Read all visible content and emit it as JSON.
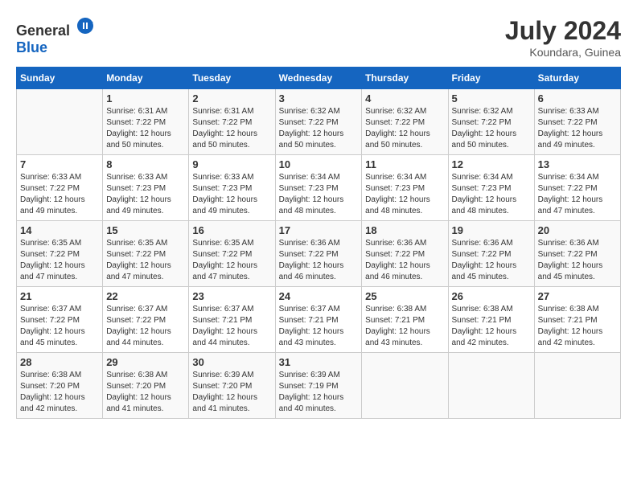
{
  "header": {
    "logo_general": "General",
    "logo_blue": "Blue",
    "month_year": "July 2024",
    "location": "Koundara, Guinea"
  },
  "days_of_week": [
    "Sunday",
    "Monday",
    "Tuesday",
    "Wednesday",
    "Thursday",
    "Friday",
    "Saturday"
  ],
  "weeks": [
    [
      {
        "day": "",
        "sunrise": "",
        "sunset": "",
        "daylight": ""
      },
      {
        "day": "1",
        "sunrise": "Sunrise: 6:31 AM",
        "sunset": "Sunset: 7:22 PM",
        "daylight": "Daylight: 12 hours and 50 minutes."
      },
      {
        "day": "2",
        "sunrise": "Sunrise: 6:31 AM",
        "sunset": "Sunset: 7:22 PM",
        "daylight": "Daylight: 12 hours and 50 minutes."
      },
      {
        "day": "3",
        "sunrise": "Sunrise: 6:32 AM",
        "sunset": "Sunset: 7:22 PM",
        "daylight": "Daylight: 12 hours and 50 minutes."
      },
      {
        "day": "4",
        "sunrise": "Sunrise: 6:32 AM",
        "sunset": "Sunset: 7:22 PM",
        "daylight": "Daylight: 12 hours and 50 minutes."
      },
      {
        "day": "5",
        "sunrise": "Sunrise: 6:32 AM",
        "sunset": "Sunset: 7:22 PM",
        "daylight": "Daylight: 12 hours and 50 minutes."
      },
      {
        "day": "6",
        "sunrise": "Sunrise: 6:33 AM",
        "sunset": "Sunset: 7:22 PM",
        "daylight": "Daylight: 12 hours and 49 minutes."
      }
    ],
    [
      {
        "day": "7",
        "sunrise": "Sunrise: 6:33 AM",
        "sunset": "Sunset: 7:22 PM",
        "daylight": "Daylight: 12 hours and 49 minutes."
      },
      {
        "day": "8",
        "sunrise": "Sunrise: 6:33 AM",
        "sunset": "Sunset: 7:23 PM",
        "daylight": "Daylight: 12 hours and 49 minutes."
      },
      {
        "day": "9",
        "sunrise": "Sunrise: 6:33 AM",
        "sunset": "Sunset: 7:23 PM",
        "daylight": "Daylight: 12 hours and 49 minutes."
      },
      {
        "day": "10",
        "sunrise": "Sunrise: 6:34 AM",
        "sunset": "Sunset: 7:23 PM",
        "daylight": "Daylight: 12 hours and 48 minutes."
      },
      {
        "day": "11",
        "sunrise": "Sunrise: 6:34 AM",
        "sunset": "Sunset: 7:23 PM",
        "daylight": "Daylight: 12 hours and 48 minutes."
      },
      {
        "day": "12",
        "sunrise": "Sunrise: 6:34 AM",
        "sunset": "Sunset: 7:23 PM",
        "daylight": "Daylight: 12 hours and 48 minutes."
      },
      {
        "day": "13",
        "sunrise": "Sunrise: 6:34 AM",
        "sunset": "Sunset: 7:22 PM",
        "daylight": "Daylight: 12 hours and 47 minutes."
      }
    ],
    [
      {
        "day": "14",
        "sunrise": "Sunrise: 6:35 AM",
        "sunset": "Sunset: 7:22 PM",
        "daylight": "Daylight: 12 hours and 47 minutes."
      },
      {
        "day": "15",
        "sunrise": "Sunrise: 6:35 AM",
        "sunset": "Sunset: 7:22 PM",
        "daylight": "Daylight: 12 hours and 47 minutes."
      },
      {
        "day": "16",
        "sunrise": "Sunrise: 6:35 AM",
        "sunset": "Sunset: 7:22 PM",
        "daylight": "Daylight: 12 hours and 47 minutes."
      },
      {
        "day": "17",
        "sunrise": "Sunrise: 6:36 AM",
        "sunset": "Sunset: 7:22 PM",
        "daylight": "Daylight: 12 hours and 46 minutes."
      },
      {
        "day": "18",
        "sunrise": "Sunrise: 6:36 AM",
        "sunset": "Sunset: 7:22 PM",
        "daylight": "Daylight: 12 hours and 46 minutes."
      },
      {
        "day": "19",
        "sunrise": "Sunrise: 6:36 AM",
        "sunset": "Sunset: 7:22 PM",
        "daylight": "Daylight: 12 hours and 45 minutes."
      },
      {
        "day": "20",
        "sunrise": "Sunrise: 6:36 AM",
        "sunset": "Sunset: 7:22 PM",
        "daylight": "Daylight: 12 hours and 45 minutes."
      }
    ],
    [
      {
        "day": "21",
        "sunrise": "Sunrise: 6:37 AM",
        "sunset": "Sunset: 7:22 PM",
        "daylight": "Daylight: 12 hours and 45 minutes."
      },
      {
        "day": "22",
        "sunrise": "Sunrise: 6:37 AM",
        "sunset": "Sunset: 7:22 PM",
        "daylight": "Daylight: 12 hours and 44 minutes."
      },
      {
        "day": "23",
        "sunrise": "Sunrise: 6:37 AM",
        "sunset": "Sunset: 7:21 PM",
        "daylight": "Daylight: 12 hours and 44 minutes."
      },
      {
        "day": "24",
        "sunrise": "Sunrise: 6:37 AM",
        "sunset": "Sunset: 7:21 PM",
        "daylight": "Daylight: 12 hours and 43 minutes."
      },
      {
        "day": "25",
        "sunrise": "Sunrise: 6:38 AM",
        "sunset": "Sunset: 7:21 PM",
        "daylight": "Daylight: 12 hours and 43 minutes."
      },
      {
        "day": "26",
        "sunrise": "Sunrise: 6:38 AM",
        "sunset": "Sunset: 7:21 PM",
        "daylight": "Daylight: 12 hours and 42 minutes."
      },
      {
        "day": "27",
        "sunrise": "Sunrise: 6:38 AM",
        "sunset": "Sunset: 7:21 PM",
        "daylight": "Daylight: 12 hours and 42 minutes."
      }
    ],
    [
      {
        "day": "28",
        "sunrise": "Sunrise: 6:38 AM",
        "sunset": "Sunset: 7:20 PM",
        "daylight": "Daylight: 12 hours and 42 minutes."
      },
      {
        "day": "29",
        "sunrise": "Sunrise: 6:38 AM",
        "sunset": "Sunset: 7:20 PM",
        "daylight": "Daylight: 12 hours and 41 minutes."
      },
      {
        "day": "30",
        "sunrise": "Sunrise: 6:39 AM",
        "sunset": "Sunset: 7:20 PM",
        "daylight": "Daylight: 12 hours and 41 minutes."
      },
      {
        "day": "31",
        "sunrise": "Sunrise: 6:39 AM",
        "sunset": "Sunset: 7:19 PM",
        "daylight": "Daylight: 12 hours and 40 minutes."
      },
      {
        "day": "",
        "sunrise": "",
        "sunset": "",
        "daylight": ""
      },
      {
        "day": "",
        "sunrise": "",
        "sunset": "",
        "daylight": ""
      },
      {
        "day": "",
        "sunrise": "",
        "sunset": "",
        "daylight": ""
      }
    ]
  ]
}
